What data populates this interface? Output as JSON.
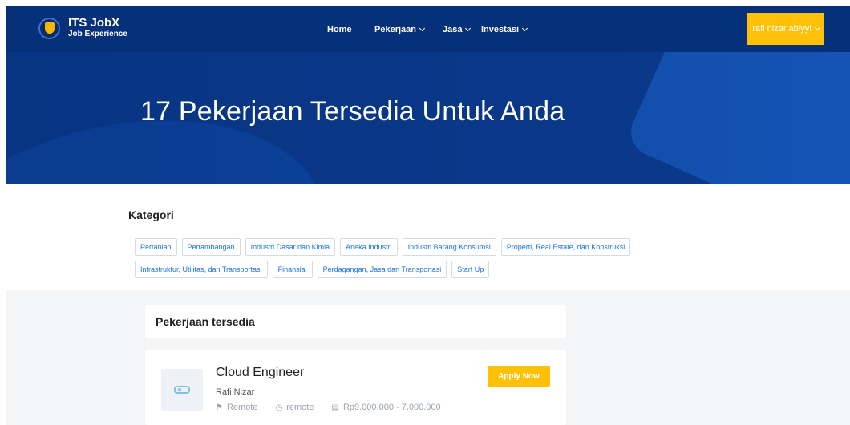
{
  "brand": {
    "title": "ITS JobX",
    "subtitle": "Job Experience"
  },
  "nav": {
    "home": "Home",
    "pekerjaan": "Pekerjaan",
    "jasa": "Jasa",
    "investasi": "Investasi",
    "user": "rafi nizar abiyyi"
  },
  "hero": {
    "title": "17 Pekerjaan Tersedia Untuk Anda"
  },
  "kategori": {
    "title": "Kategori",
    "items": [
      "Pertanian",
      "Pertambangan",
      "Industri Dasar dan Kimia",
      "Aneka Industri",
      "Industri Barang Konsumsi",
      "Properti, Real Estate, dan Konstruksi",
      "Infrastruktur, Utilitas, dan Transportasi",
      "Finansial",
      "Perdagangan, Jasa dan Transportasi",
      "Start Up"
    ]
  },
  "jobs_section": {
    "title": "Pekerjaan tersedia"
  },
  "job": {
    "title": "Cloud Engineer",
    "company": "Rafi Nizar",
    "location": "Remote",
    "type": "remote",
    "salary": "Rp9.000.000 - 7.000.000",
    "apply_label": "Apply Now"
  },
  "colors": {
    "primary": "#0a3a8c",
    "accent": "#ffc107",
    "link": "#1a73e8"
  }
}
